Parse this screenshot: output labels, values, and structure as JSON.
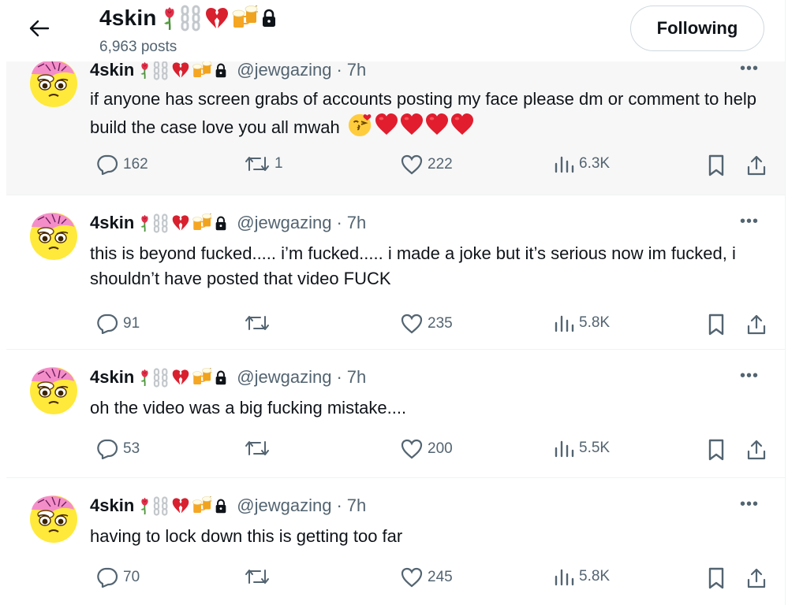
{
  "header": {
    "name": "4skin",
    "post_count": "6,963 posts",
    "follow_label": "Following",
    "badge_emojis": [
      "rose-icon",
      "chains-icon",
      "broken-heart-icon",
      "beer-icon",
      "lock-icon"
    ]
  },
  "colors": {
    "text": "#0f1419",
    "muted": "#536471",
    "border": "#eff3f4",
    "heart_red": "#e11d2e"
  },
  "tweets": [
    {
      "name": "4skin",
      "handle": "@jewgazing",
      "time": "7h",
      "text": "if anyone has screen grabs of accounts posting my face please dm or comment to help build the case love you all mwah",
      "trailing_emojis": [
        "kiss-face-icon",
        "heart-icon",
        "heart-icon",
        "heart-icon",
        "heart-icon"
      ],
      "replies": "162",
      "reposts": "1",
      "likes": "222",
      "views": "6.3K"
    },
    {
      "name": "4skin",
      "handle": "@jewgazing",
      "time": "7h",
      "text": "this is beyond fucked..... i’m fucked..... i made a joke but it’s serious now im fucked, i shouldn’t have posted that video FUCK",
      "replies": "91",
      "reposts": "",
      "likes": "235",
      "views": "5.8K"
    },
    {
      "name": "4skin",
      "handle": "@jewgazing",
      "time": "7h",
      "text": "oh the video was a big fucking mistake....",
      "replies": "53",
      "reposts": "",
      "likes": "200",
      "views": "5.5K"
    },
    {
      "name": "4skin",
      "handle": "@jewgazing",
      "time": "7h",
      "text": "having to lock down this is getting too far",
      "replies": "70",
      "reposts": "",
      "likes": "245",
      "views": "5.8K"
    }
  ]
}
